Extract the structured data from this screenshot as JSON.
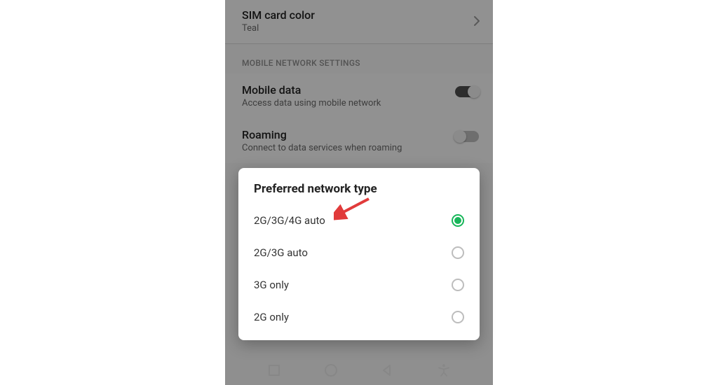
{
  "settings": {
    "sim_color": {
      "title": "SIM card color",
      "value": "Teal"
    },
    "section_header": "MOBILE NETWORK SETTINGS",
    "mobile_data": {
      "title": "Mobile data",
      "subtitle": "Access data using mobile network",
      "enabled": true
    },
    "roaming": {
      "title": "Roaming",
      "subtitle": "Connect to data services when roaming",
      "enabled": false
    }
  },
  "dialog": {
    "title": "Preferred network type",
    "options": [
      {
        "label": "2G/3G/4G auto",
        "selected": true
      },
      {
        "label": "2G/3G auto",
        "selected": false
      },
      {
        "label": "3G only",
        "selected": false
      },
      {
        "label": "2G only",
        "selected": false
      }
    ]
  },
  "colors": {
    "accent": "#18b65a",
    "arrow": "#e13b3b"
  }
}
